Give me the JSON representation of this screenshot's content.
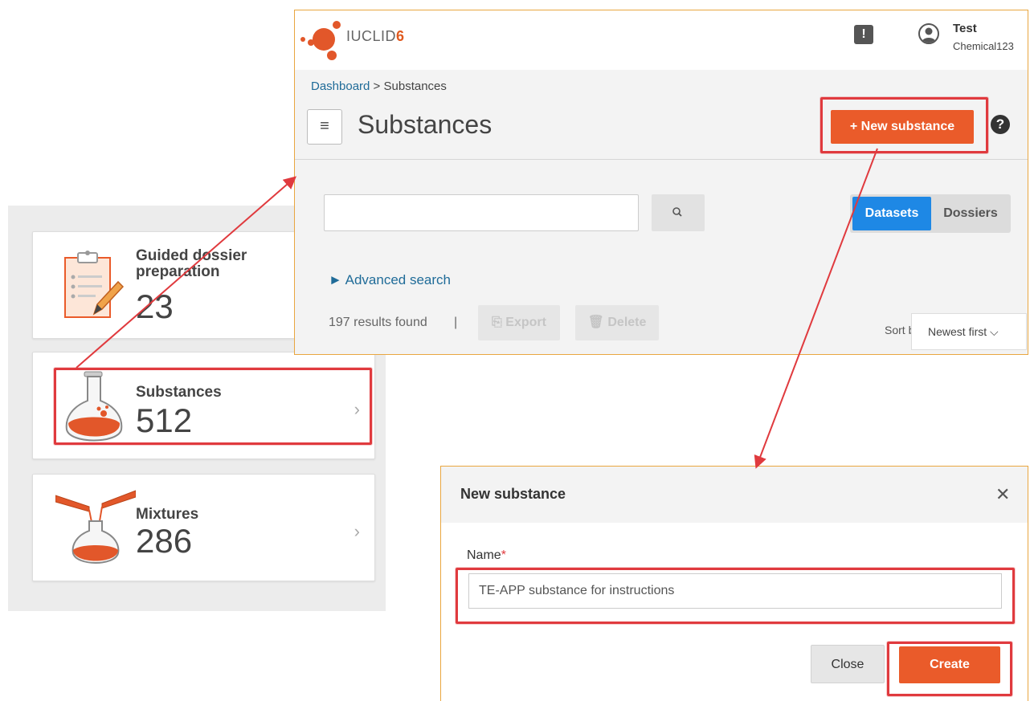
{
  "colors": {
    "accent_orange": "#ea5b2a",
    "highlight_red": "#e03a3e",
    "link_blue": "#1f6b98",
    "toggle_blue": "#1e88e5"
  },
  "dashboard": {
    "cards": [
      {
        "title": "Guided dossier preparation",
        "count": "23",
        "icon": "clipboard-pencil-icon"
      },
      {
        "title": "Substances",
        "count": "512",
        "icon": "flask-icon"
      },
      {
        "title": "Mixtures",
        "count": "286",
        "icon": "mixing-flasks-icon"
      }
    ],
    "chevron": "›"
  },
  "app": {
    "logo_text": "IUCLID",
    "logo_version": "6",
    "user_name": "Test",
    "user_sub": "Chemical123",
    "feedback_glyph": "!",
    "breadcrumb": {
      "link": "Dashboard",
      "separator": " > ",
      "current": "Substances"
    },
    "menu_glyph": "≡",
    "page_title": "Substances",
    "new_button": "+ New substance",
    "help_glyph": "?",
    "search": {
      "value": "",
      "placeholder": ""
    },
    "toggle": {
      "active": "Datasets",
      "other": "Dossiers"
    },
    "advanced_search": "► Advanced search",
    "results": "197 results found",
    "separator": "|",
    "export": "⎘ Export",
    "delete": "🗑 Delete",
    "sort_label": "Sort by",
    "sort_value": "Newest first ⌵"
  },
  "modal": {
    "title": "New substance",
    "close_glyph": "✕",
    "name_label": "Name",
    "required_mark": "*",
    "name_value": "TE-APP substance for instructions",
    "close_button": "Close",
    "create_button": "Create"
  }
}
